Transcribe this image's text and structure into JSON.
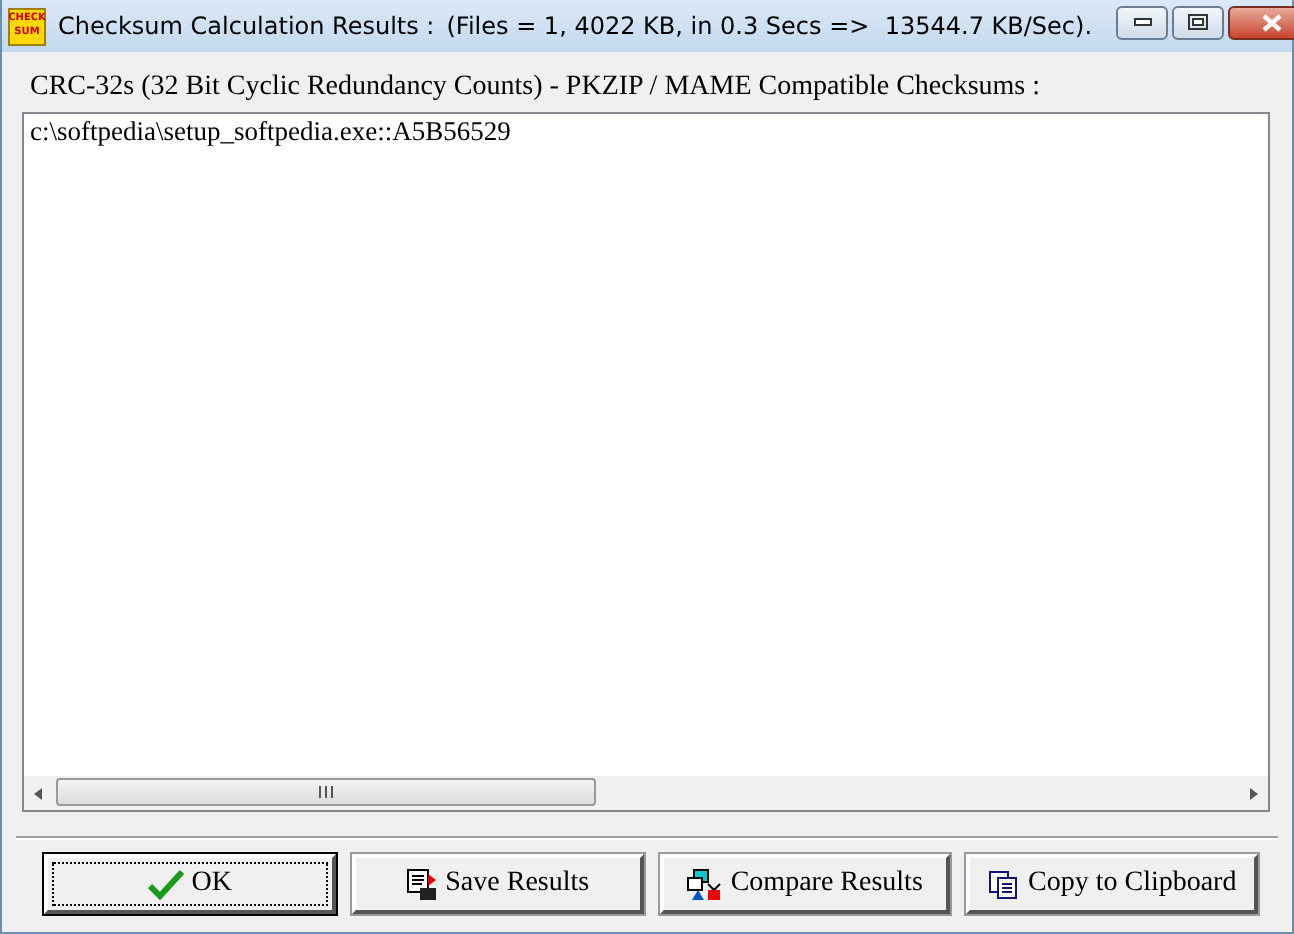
{
  "window": {
    "logo": [
      "CHECK",
      "SUM"
    ],
    "title": "Checksum Calculation Results :",
    "stats": "(Files = 1, 4022 KB, in 0.3 Secs =>  13544.7 KB/Sec)."
  },
  "results": {
    "heading": "CRC-32s (32 Bit Cyclic Redundancy Counts) - PKZIP / MAME Compatible Checksums :",
    "lines": [
      "c:\\softpedia\\setup_softpedia.exe::A5B56529"
    ]
  },
  "buttons": [
    {
      "kind": "ok",
      "label": "OK",
      "focused": true
    },
    {
      "kind": "save",
      "label": "Save Results",
      "focused": false
    },
    {
      "kind": "compare",
      "label": "Compare Results",
      "focused": false
    },
    {
      "kind": "copy",
      "label": "Copy to Clipboard",
      "focused": false
    }
  ]
}
